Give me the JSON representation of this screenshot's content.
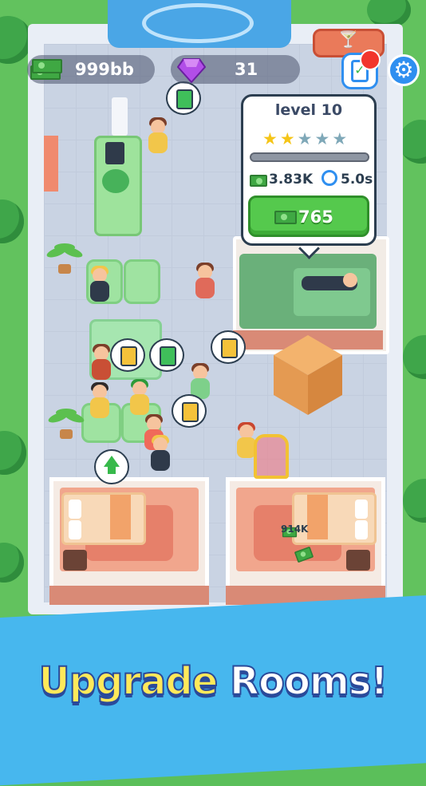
{
  "hud": {
    "cash_amount": "999bb",
    "gem_amount": "31",
    "cash_icon": "cash-stack-icon",
    "gem_icon": "purple-gem-icon",
    "settings_icon": "gear-icon",
    "tasks_icon": "clipboard-check-icon"
  },
  "upgrade_popup": {
    "level_label": "level 10",
    "stars_filled": 2,
    "stars_total": 5,
    "progress_fraction": 0.0,
    "income_value": "3.83K",
    "time_value": "5.0s",
    "upgrade_price": "765"
  },
  "room_income": {
    "amount": "914K"
  },
  "banner": {
    "headline_word1": "Upgrade",
    "headline_word2": "Rooms!"
  },
  "colors": {
    "accent_blue": "#47b7ee",
    "button_green": "#55c94d",
    "headline_yellow": "#ffe95a",
    "star_gold": "#f5c518",
    "star_empty": "#7fa8b8"
  }
}
